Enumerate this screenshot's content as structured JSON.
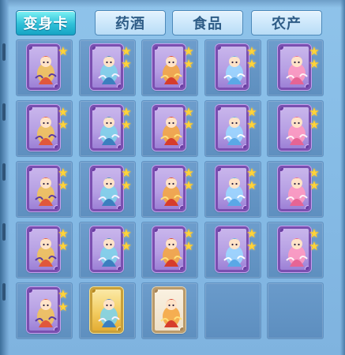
{
  "tabs": [
    {
      "label": "变身卡",
      "active": true
    },
    {
      "label": "药酒",
      "active": false
    },
    {
      "label": "食品",
      "active": false
    },
    {
      "label": "农产",
      "active": false
    }
  ],
  "star_glyph": "★",
  "grid": {
    "columns": 5,
    "rows": 5,
    "slots": [
      {
        "item": "card-whitehair-sage",
        "frame": "purple",
        "stars": 1
      },
      {
        "item": "card-swordsman",
        "frame": "purple",
        "stars": 2
      },
      {
        "item": "card-golden-lion",
        "frame": "purple",
        "stars": 2
      },
      {
        "item": "card-golden-lion",
        "frame": "purple",
        "stars": 2
      },
      {
        "item": "card-golden-lion",
        "frame": "purple",
        "stars": 2
      },
      {
        "item": "card-golden-lion",
        "frame": "purple",
        "stars": 2
      },
      {
        "item": "card-golden-lion",
        "frame": "purple",
        "stars": 2
      },
      {
        "item": "card-rider-warrior",
        "frame": "purple",
        "stars": 2
      },
      {
        "item": "card-blue-mage",
        "frame": "purple",
        "stars": 2
      },
      {
        "item": "card-ice-deer",
        "frame": "purple",
        "stars": 2
      },
      {
        "item": "card-armored-general",
        "frame": "purple",
        "stars": 2
      },
      {
        "item": "card-crystal-fairy",
        "frame": "purple",
        "stars": 2
      },
      {
        "item": "card-crystal-fairy",
        "frame": "purple",
        "stars": 2
      },
      {
        "item": "card-rabbit-girl",
        "frame": "purple",
        "stars": 2
      },
      {
        "item": "card-fire-fox",
        "frame": "purple",
        "stars": 2
      },
      {
        "item": "card-frost-knight",
        "frame": "purple",
        "stars": 2
      },
      {
        "item": "card-winged-demon",
        "frame": "purple",
        "stars": 2
      },
      {
        "item": "card-red-dragonfly",
        "frame": "purple",
        "stars": 2
      },
      {
        "item": "card-dark-maiden",
        "frame": "purple",
        "stars": 2
      },
      {
        "item": "card-flame-fox",
        "frame": "purple",
        "stars": 2
      },
      {
        "item": "card-bronze-warrior",
        "frame": "purple",
        "stars": 2
      },
      {
        "item": "card-red-haired-hero",
        "frame": "gold",
        "stars": 0
      },
      {
        "item": "card-pink-girl",
        "frame": "cream",
        "stars": 0
      },
      {
        "item": "",
        "frame": "none",
        "stars": 0
      },
      {
        "item": "",
        "frame": "none",
        "stars": 0
      }
    ]
  },
  "colors": {
    "panel_bg": "#86bce6",
    "slot_bg": "#6594c4",
    "tab_active": "#2fc1d9",
    "tab_inactive": "#cfe8fa",
    "star": "#ffd43a",
    "card_frame_purple": "#7a4fb0",
    "card_frame_gold": "#c9a03a"
  }
}
